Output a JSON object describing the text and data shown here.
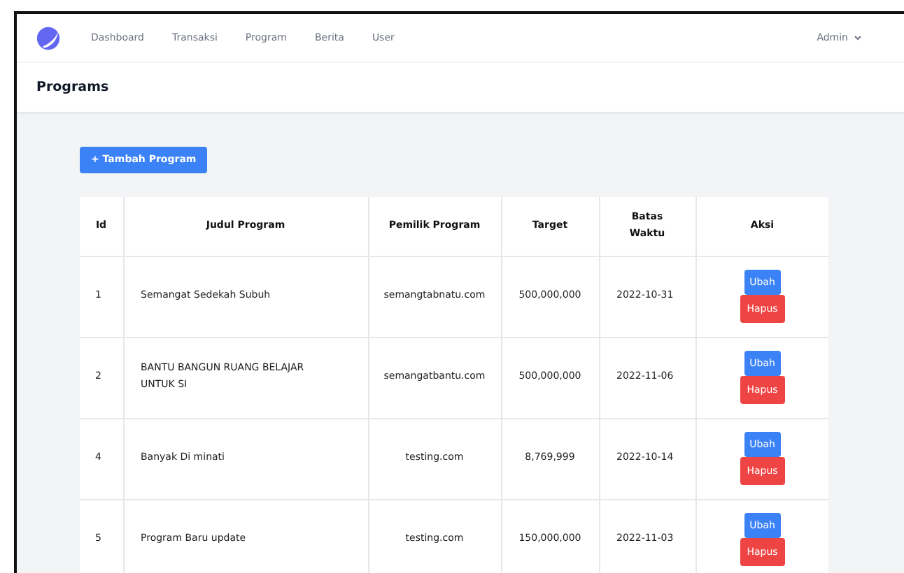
{
  "nav": {
    "items": [
      {
        "label": "Dashboard",
        "selected": false
      },
      {
        "label": "Transaksi",
        "selected": false
      },
      {
        "label": "Program",
        "selected": false
      },
      {
        "label": "Berita",
        "selected": false
      },
      {
        "label": "User",
        "selected": false
      }
    ],
    "user": "Admin"
  },
  "header": {
    "title": "Programs"
  },
  "add_button": "+ Tambah Program",
  "table": {
    "columns": [
      "Id",
      "Judul Program",
      "Pemilik Program",
      "Target",
      "Batas Waktu",
      "Aksi"
    ],
    "rows": [
      {
        "id": "1",
        "title": "Semangat Sedekah Subuh",
        "owner": "semangtabnatu.com",
        "target": "500,000,000",
        "deadline": "2022-10-31",
        "actions": [
          "Ubah",
          "Hapus"
        ]
      },
      {
        "id": "2",
        "title": "BANTU BANGUN RUANG BELAJAR UNTUK SI",
        "owner": "semangatbantu.com",
        "target": "500,000,000",
        "deadline": "2022-11-06",
        "actions": [
          "Ubah",
          "Hapus"
        ]
      },
      {
        "id": "4",
        "title": "Banyak Di minati",
        "owner": "testing.com",
        "target": "8,769,999",
        "deadline": "2022-10-14",
        "actions": [
          "Ubah",
          "Hapus"
        ]
      },
      {
        "id": "5",
        "title": "Program Baru update",
        "owner": "testing.com",
        "target": "150,000,000",
        "deadline": "2022-11-03",
        "actions": [
          "Ubah",
          "Hapus"
        ]
      }
    ]
  }
}
